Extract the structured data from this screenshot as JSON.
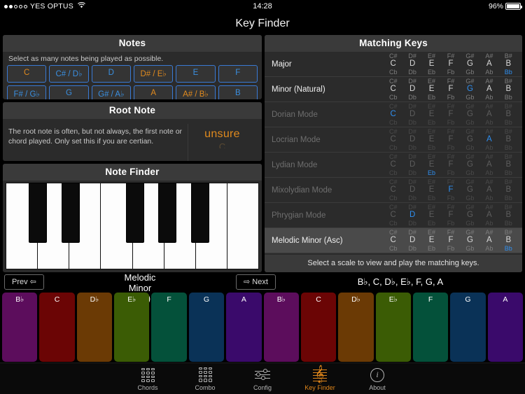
{
  "statusbar": {
    "carrier": "YES OPTUS",
    "time": "14:28",
    "battery": "96%",
    "signal_filled": 2,
    "signal_total": 5
  },
  "nav": {
    "title": "Key Finder"
  },
  "notes_panel": {
    "title": "Notes",
    "subtitle": "Select as many notes being played as possible.",
    "buttons": [
      {
        "label": "C",
        "selected": true
      },
      {
        "label": "C# / D♭",
        "selected": false
      },
      {
        "label": "D",
        "selected": false
      },
      {
        "label": "D# / E♭",
        "selected": true
      },
      {
        "label": "E",
        "selected": false
      },
      {
        "label": "F",
        "selected": false
      },
      {
        "label": "F# / G♭",
        "selected": false
      },
      {
        "label": "G",
        "selected": false
      },
      {
        "label": "G# / A♭",
        "selected": false
      },
      {
        "label": "A",
        "selected": true
      },
      {
        "label": "A# / B♭",
        "selected": true
      },
      {
        "label": "B",
        "selected": false
      }
    ]
  },
  "root_panel": {
    "title": "Root Note",
    "description": "The root note is often, but not always, the first note or chord played. Only set this if you are certian.",
    "picker_value": "unsure",
    "picker_next": "C"
  },
  "note_finder": {
    "title": "Note Finder",
    "white_keys": 8,
    "black_keys": 5
  },
  "matching_keys": {
    "title": "Matching Keys",
    "footer": "Select a scale to view and play the matching keys.",
    "columns_sharp": [
      "C#",
      "D#",
      "E#",
      "F#",
      "G#",
      "A#",
      "B#"
    ],
    "columns_natural": [
      "C",
      "D",
      "E",
      "F",
      "G",
      "A",
      "B"
    ],
    "columns_flat": [
      "Cb",
      "Db",
      "Eb",
      "Fb",
      "Gb",
      "Ab",
      "Bb"
    ],
    "rows": [
      {
        "name": "Major",
        "dim": false,
        "active": false,
        "highlight": {
          "row": "flat",
          "index": 6
        }
      },
      {
        "name": "Minor (Natural)",
        "dim": false,
        "active": false,
        "highlight": {
          "row": "natural",
          "index": 4
        }
      },
      {
        "name": "Dorian Mode",
        "dim": true,
        "active": false,
        "highlight": {
          "row": "natural",
          "index": 0
        }
      },
      {
        "name": "Locrian Mode",
        "dim": true,
        "active": false,
        "highlight": {
          "row": "natural",
          "index": 5
        }
      },
      {
        "name": "Lydian Mode",
        "dim": true,
        "active": false,
        "highlight": {
          "row": "flat",
          "index": 2
        }
      },
      {
        "name": "Mixolydian Mode",
        "dim": true,
        "active": false,
        "highlight": {
          "row": "natural",
          "index": 3
        }
      },
      {
        "name": "Phrygian Mode",
        "dim": true,
        "active": false,
        "highlight": {
          "row": "natural",
          "index": 1
        }
      },
      {
        "name": "Melodic Minor (Asc)",
        "dim": false,
        "active": true,
        "highlight": {
          "row": "flat",
          "index": 6
        }
      }
    ]
  },
  "transport": {
    "prev_label": "Prev ⇦",
    "next_label": "⇨ Next",
    "scale_name": "B♭ Melodic Minor (Asc)",
    "scale_notes": "B♭, C, D♭, E♭, F, G, A"
  },
  "color_keys": [
    {
      "label": "B♭",
      "color": "#5c0d5c"
    },
    {
      "label": "C",
      "color": "#6b0505"
    },
    {
      "label": "D♭",
      "color": "#6b3a05"
    },
    {
      "label": "E♭",
      "color": "#3b5c05"
    },
    {
      "label": "F",
      "color": "#04513a"
    },
    {
      "label": "G",
      "color": "#0a3257"
    },
    {
      "label": "A",
      "color": "#3a0a6b"
    },
    {
      "label": "B♭",
      "color": "#5c0d5c"
    },
    {
      "label": "C",
      "color": "#6b0505"
    },
    {
      "label": "D♭",
      "color": "#6b3a05"
    },
    {
      "label": "E♭",
      "color": "#3b5c05"
    },
    {
      "label": "F",
      "color": "#04513a"
    },
    {
      "label": "G",
      "color": "#0a3257"
    },
    {
      "label": "A",
      "color": "#3a0a6b"
    }
  ],
  "tabbar": {
    "items": [
      {
        "label": "Chords",
        "icon": "grid-icon",
        "active": false
      },
      {
        "label": "Combo",
        "icon": "grid-bars-icon",
        "active": false
      },
      {
        "label": "Config",
        "icon": "sliders-icon",
        "active": false
      },
      {
        "label": "Key Finder",
        "icon": "treble-clef-icon",
        "active": true
      },
      {
        "label": "About",
        "icon": "info-circle-icon",
        "active": false
      }
    ]
  },
  "colors": {
    "accent": "#e0861a",
    "blue": "#3a8fe0",
    "highlight_blue": "#2f8ff0",
    "panel": "#2b2b2b",
    "header": "#3a3a3a"
  }
}
